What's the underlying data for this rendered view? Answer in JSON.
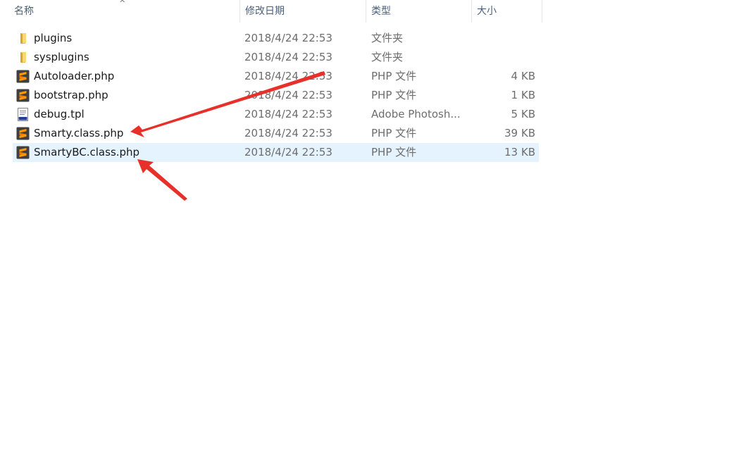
{
  "columns": {
    "name": "名称",
    "modified": "修改日期",
    "type": "类型",
    "size": "大小"
  },
  "sort_indicator": "^",
  "files": [
    {
      "name": "plugins",
      "modified": "2018/4/24 22:53",
      "type": "文件夹",
      "size": "",
      "icon": "folder-icon"
    },
    {
      "name": "sysplugins",
      "modified": "2018/4/24 22:53",
      "type": "文件夹",
      "size": "",
      "icon": "folder-icon"
    },
    {
      "name": "Autoloader.php",
      "modified": "2018/4/24 22:53",
      "type": "PHP 文件",
      "size": "4 KB",
      "icon": "sublime-php-icon"
    },
    {
      "name": "bootstrap.php",
      "modified": "2018/4/24 22:53",
      "type": "PHP 文件",
      "size": "1 KB",
      "icon": "sublime-php-icon"
    },
    {
      "name": "debug.tpl",
      "modified": "2018/4/24 22:53",
      "type": "Adobe Photosh...",
      "size": "5 KB",
      "icon": "template-file-icon"
    },
    {
      "name": "Smarty.class.php",
      "modified": "2018/4/24 22:53",
      "type": "PHP 文件",
      "size": "39 KB",
      "icon": "sublime-php-icon"
    },
    {
      "name": "SmartyBC.class.php",
      "modified": "2018/4/24 22:53",
      "type": "PHP 文件",
      "size": "13 KB",
      "icon": "sublime-php-icon",
      "selected": true
    }
  ],
  "colors": {
    "selection": "#e5f3ff",
    "annotation_arrow": "#e8302a",
    "header_text": "#4c607a",
    "sublime_orange": "#ff9800"
  }
}
